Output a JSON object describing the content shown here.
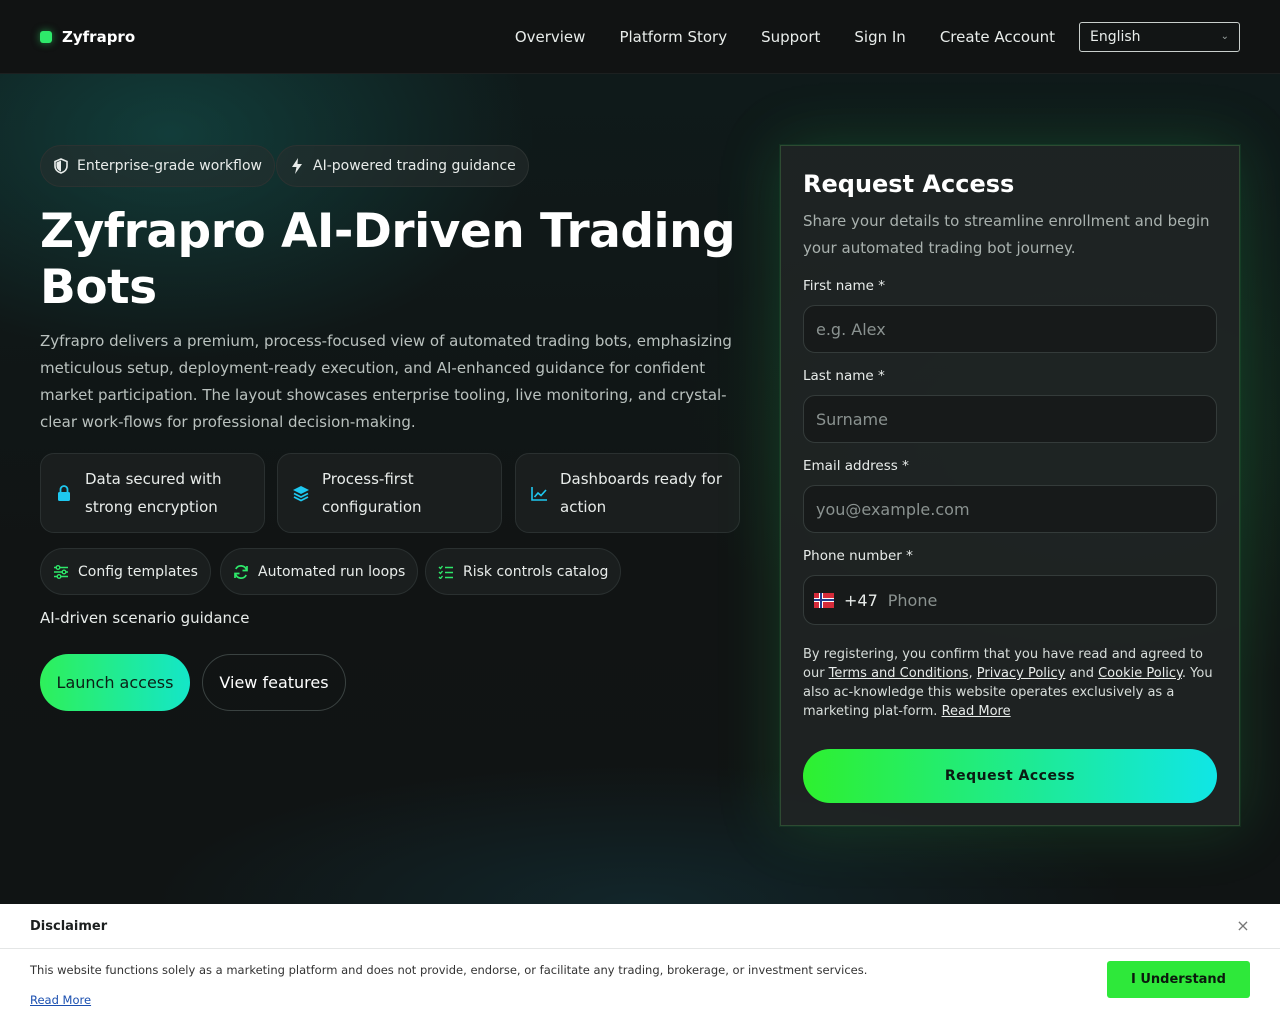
{
  "header": {
    "logo_text": "Zyfrapro",
    "nav": [
      "Overview",
      "Platform Story",
      "Support",
      "Sign In",
      "Create Account"
    ],
    "language": "English"
  },
  "hero": {
    "pills": [
      "Enterprise-grade workflow",
      "AI-powered trading guidance"
    ],
    "headline": "Zyfrapro AI-Driven Trading Bots",
    "intro": "Zyfrapro delivers a premium, process-focused view of automated trading bots, emphasizing meticulous setup, deployment-ready execution, and AI-enhanced guidance for confident market participation. The layout showcases enterprise tooling, live monitoring, and crystal-clear work-flows for professional decision-making.",
    "cards": [
      "Data secured with strong encryption",
      "Process-first configuration",
      "Dashboards ready for action"
    ],
    "tags": [
      "Config templates",
      "Automated run loops",
      "Risk controls catalog"
    ],
    "guidance": "AI-driven scenario guidance",
    "launch_label": "Launch access",
    "view_label": "View features"
  },
  "form": {
    "title": "Request Access",
    "subtitle": "Share your details to streamline enrollment and begin your automated trading bot journey.",
    "first_name_label": "First name *",
    "first_name_placeholder": "e.g. Alex",
    "last_name_label": "Last name *",
    "last_name_placeholder": "Surname",
    "email_label": "Email address *",
    "email_placeholder": "you@example.com",
    "phone_label": "Phone number *",
    "phone_dial": "+47",
    "phone_placeholder": "Phone",
    "legal_prefix": "By registering, you confirm that you have read and agreed to our ",
    "terms_link": "Terms and Conditions",
    "comma": ", ",
    "privacy_link": "Privacy Policy",
    "and_text": " and ",
    "cookie_link": "Cookie Policy",
    "legal_suffix": ". You also ac-knowledge this website operates exclusively as a marketing plat-form. ",
    "read_more": "Read More",
    "submit_label": "Request Access"
  },
  "disclaimer": {
    "title": "Disclaimer",
    "text": "This website functions solely as a marketing platform and does not provide, endorse, or facilitate any trading, brokerage, or investment services.",
    "read_more": "Read More",
    "accept_label": "I Understand",
    "close_glyph": "×"
  },
  "colors": {
    "accent_green": "#2ee86a",
    "accent_cyan": "#14e6c8",
    "panel_bg": "#202424"
  }
}
